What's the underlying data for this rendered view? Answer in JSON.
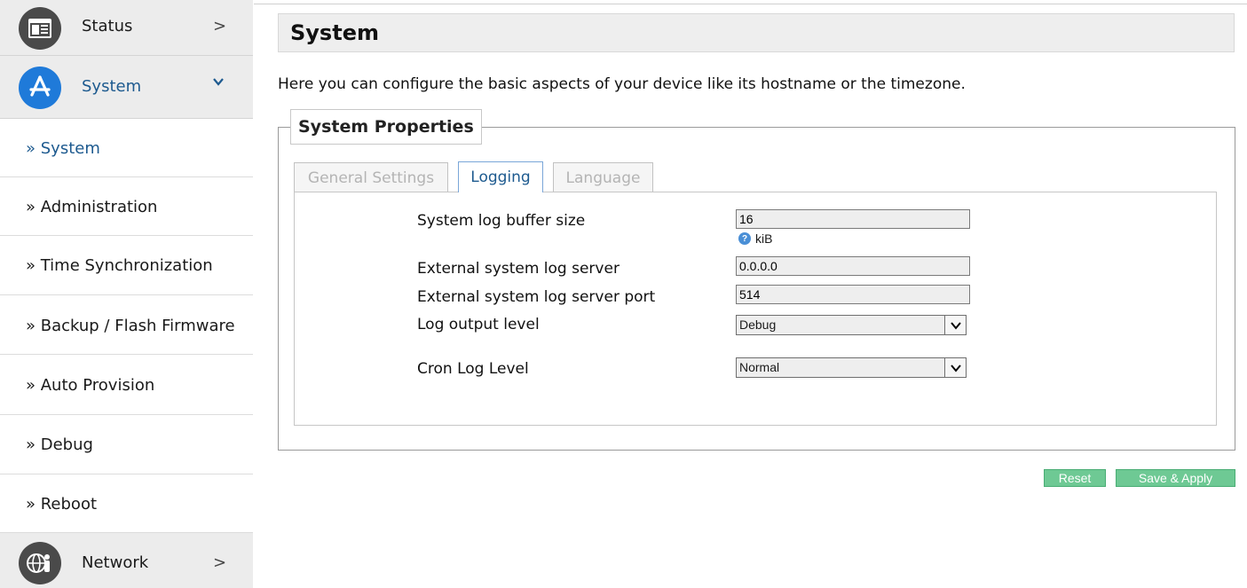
{
  "sidebar": {
    "status": {
      "label": "Status",
      "chevron": ">",
      "icon": "browser-window-icon"
    },
    "system": {
      "label": "System",
      "chevron": "⌄",
      "icon": "app-store-icon",
      "accent": "#1f7ad9"
    },
    "network": {
      "label": "Network",
      "chevron": ">",
      "icon": "globe-user-icon"
    },
    "items": [
      {
        "label": "» System",
        "active": true
      },
      {
        "label": "» Administration"
      },
      {
        "label": "» Time Synchronization"
      },
      {
        "label": "» Backup / Flash Firmware"
      },
      {
        "label": "» Auto Provision"
      },
      {
        "label": "» Debug"
      },
      {
        "label": "» Reboot"
      }
    ]
  },
  "main": {
    "title": "System",
    "intro": "Here you can configure the basic aspects of your device like its hostname or the timezone.",
    "section_title": "System Properties",
    "tabs": [
      {
        "label": "General Settings",
        "active": false
      },
      {
        "label": "Logging",
        "active": true
      },
      {
        "label": "Language",
        "active": false
      }
    ],
    "fields": {
      "buffer_size": {
        "label": "System log buffer size",
        "value": "16",
        "unit": "kiB"
      },
      "log_server": {
        "label": "External system log server",
        "value": "0.0.0.0"
      },
      "log_server_port": {
        "label": "External system log server port",
        "value": "514"
      },
      "log_output_level": {
        "label": "Log output level",
        "value": "Debug"
      },
      "cron_log_level": {
        "label": "Cron Log Level",
        "value": "Normal"
      }
    },
    "buttons": {
      "reset": "Reset",
      "save_apply": "Save & Apply"
    }
  },
  "colors": {
    "accent_blue": "#1d5a8f",
    "button_green": "#6ec994",
    "sidebar_header_bg": "#ececec",
    "title_bar_bg": "#eeeeee"
  }
}
